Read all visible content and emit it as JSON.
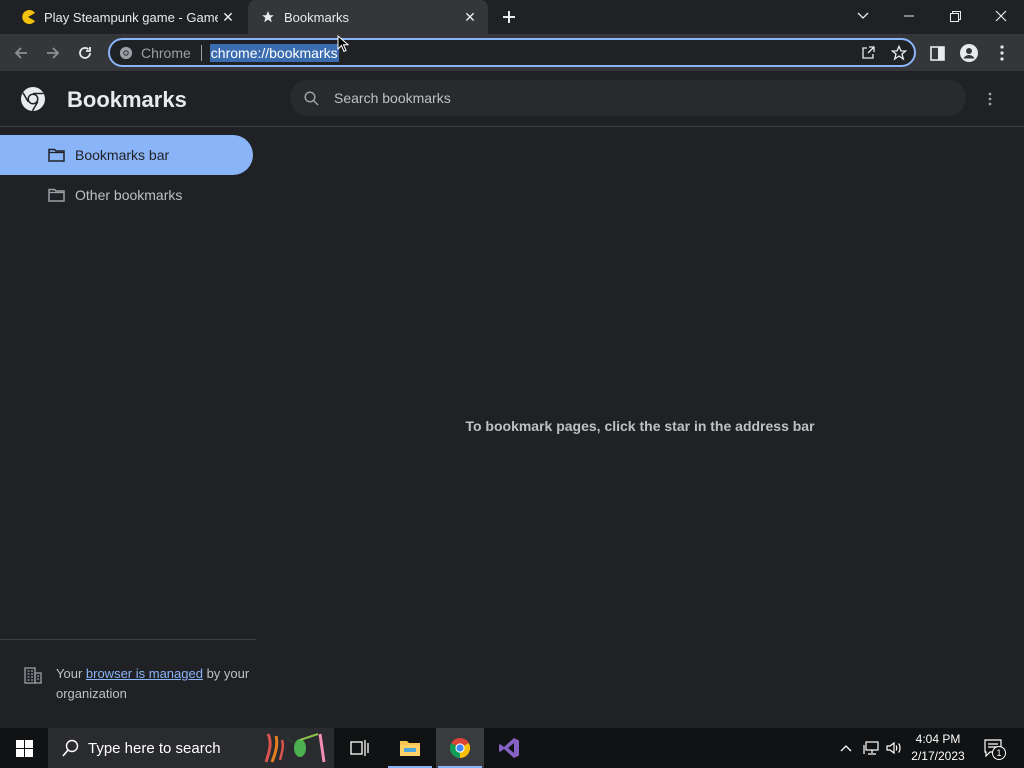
{
  "browser": {
    "tabs": [
      {
        "title": "Play Steampunk game - Gamesfl",
        "close": "✕",
        "icon": "pacman-favicon-icon"
      },
      {
        "title": "Bookmarks",
        "close": "✕",
        "icon": "star-icon"
      }
    ],
    "new_tab": "+",
    "omnibox": {
      "chip_label": "Chrome",
      "url": "chrome://bookmarks"
    }
  },
  "page": {
    "title": "Bookmarks",
    "search_placeholder": "Search bookmarks",
    "sidebar": [
      {
        "label": "Bookmarks bar",
        "selected": true
      },
      {
        "label": "Other bookmarks",
        "selected": false
      }
    ],
    "empty_message": "To bookmark pages, click the star in the address bar",
    "managed": {
      "prefix": "Your ",
      "link": "browser is managed",
      "suffix": " by your organization"
    }
  },
  "taskbar": {
    "search_placeholder": "Type here to search",
    "time": "4:04 PM",
    "date": "2/17/2023",
    "notification_count": "1"
  },
  "colors": {
    "accent": "#8ab4f8",
    "background": "#202124",
    "toolbar": "#35363a"
  }
}
